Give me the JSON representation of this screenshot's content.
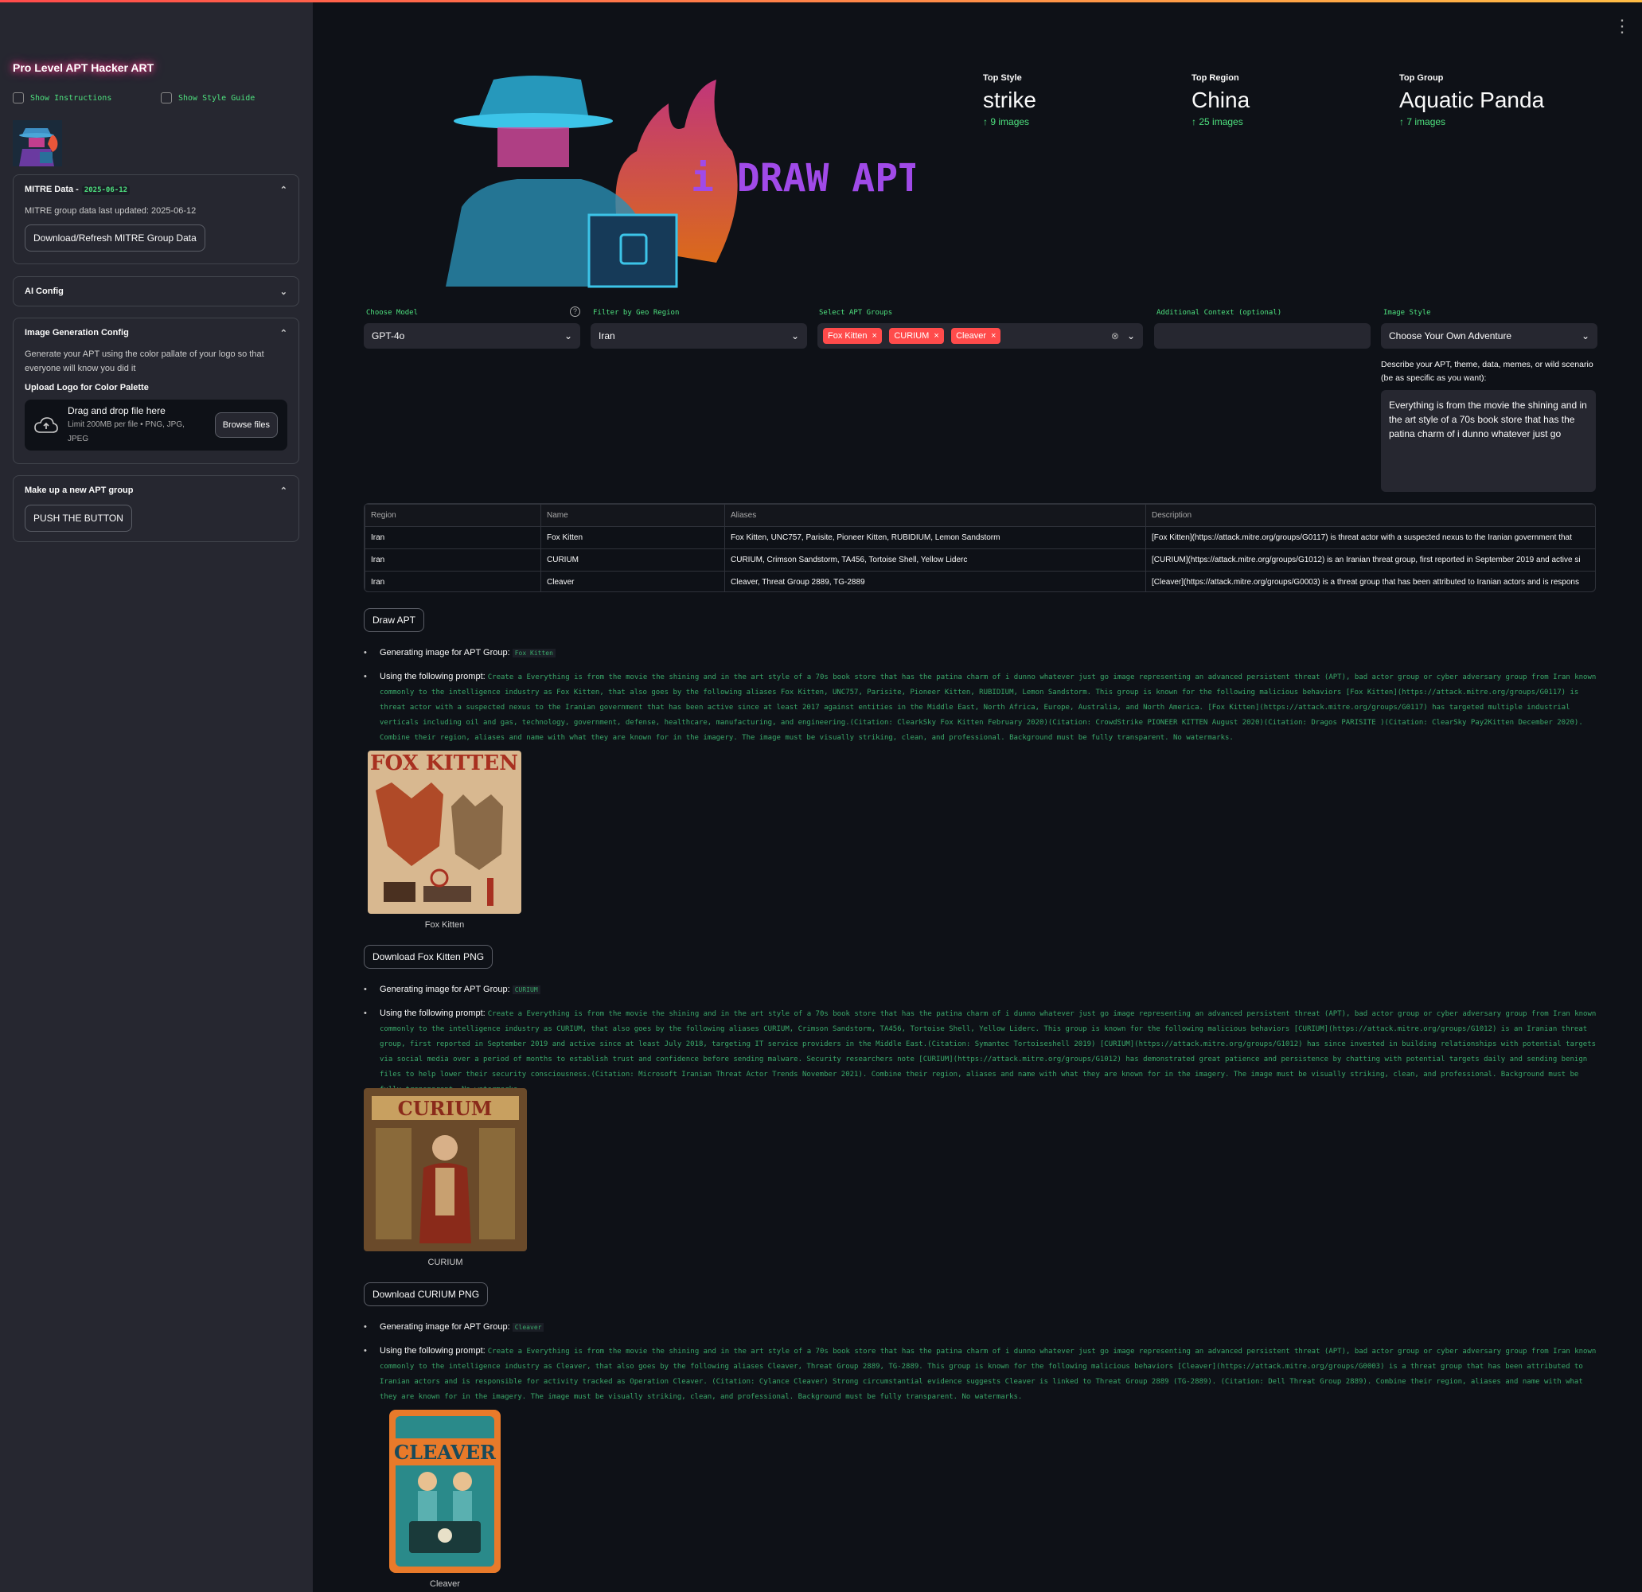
{
  "sidebar": {
    "title": "Pro Level APT Hacker ART",
    "show_instructions": "Show Instructions",
    "show_style_guide": "Show Style Guide",
    "mitre": {
      "title": "MITRE Data -",
      "date": "2025-06-12",
      "text": "MITRE group data last updated: 2025-06-12",
      "button": "Download/Refresh MITRE Group Data"
    },
    "ai_config": {
      "title": "AI Config"
    },
    "image_config": {
      "title": "Image Generation Config",
      "text": "Generate your APT using the color pallate of your logo so that everyone will know you did it",
      "upload_label": "Upload Logo for Color Palette",
      "drop_title": "Drag and drop file here",
      "drop_limit": "Limit 200MB per file • PNG, JPG, JPEG",
      "browse": "Browse files"
    },
    "new_group": {
      "title": "Make up a new APT group",
      "button": "PUSH THE BUTTON"
    }
  },
  "hero": {
    "text": "i DRAW APT"
  },
  "metrics": [
    {
      "label": "Top Style",
      "value": "strike",
      "delta": "9 images"
    },
    {
      "label": "Top Region",
      "value": "China",
      "delta": "25 images"
    },
    {
      "label": "Top Group",
      "value": "Aquatic Panda",
      "delta": "7 images"
    }
  ],
  "filters": {
    "model": {
      "label": "Choose Model",
      "value": "GPT-4o"
    },
    "region": {
      "label": "Filter by Geo Region",
      "value": "Iran"
    },
    "groups": {
      "label": "Select APT Groups",
      "tags": [
        "Fox Kitten",
        "CURIUM",
        "Cleaver"
      ]
    },
    "context": {
      "label": "Additional Context (optional)",
      "value": ""
    },
    "style": {
      "label": "Image Style",
      "value": "Choose Your Own Adventure"
    }
  },
  "describe": {
    "label": "Describe your APT, theme, data, memes, or wild scenario (be as specific as you want):",
    "value": "Everything is from the movie the shining and in the art style of a 70s book store that has the patina charm of i dunno whatever just go"
  },
  "table": {
    "headers": [
      "Region",
      "Name",
      "Aliases",
      "Description"
    ],
    "rows": [
      [
        "Iran",
        "Fox Kitten",
        "Fox Kitten, UNC757, Parisite, Pioneer Kitten, RUBIDIUM, Lemon Sandstorm",
        "[Fox Kitten](https://attack.mitre.org/groups/G0117) is threat actor with a suspected nexus to the Iranian government that"
      ],
      [
        "Iran",
        "CURIUM",
        "CURIUM, Crimson Sandstorm, TA456, Tortoise Shell, Yellow Liderc",
        "[CURIUM](https://attack.mitre.org/groups/G1012) is an Iranian threat group, first reported in September 2019 and active si"
      ],
      [
        "Iran",
        "Cleaver",
        "Cleaver, Threat Group 2889, TG-2889",
        "[Cleaver](https://attack.mitre.org/groups/G0003) is a threat group that has been attributed to Iranian actors and is respons"
      ]
    ]
  },
  "draw_button": "Draw APT",
  "generating_label": "Generating image for APT Group:",
  "prompt_label": "Using the following prompt:",
  "results": [
    {
      "group": "Fox Kitten",
      "prompt": "Create a Everything is from the movie the shining and in the art style of a 70s book store that has the patina charm of i dunno whatever just go image representing an advanced persistent threat (APT), bad actor group or cyber adversary group from Iran known commonly to the intelligence industry as Fox Kitten, that also goes by the following aliases Fox Kitten, UNC757, Parisite, Pioneer Kitten, RUBIDIUM, Lemon Sandstorm. This group is known for the following malicious behaviors [Fox Kitten](https://attack.mitre.org/groups/G0117) is threat actor with a suspected nexus to the Iranian government that has been active since at least 2017 against entities in the Middle East, North Africa, Europe, Australia, and North America. [Fox Kitten](https://attack.mitre.org/groups/G0117) has targeted multiple industrial verticals including oil and gas, technology, government, defense, healthcare, manufacturing, and engineering.(Citation: ClearkSky Fox Kitten February 2020)(Citation: CrowdStrike PIONEER KITTEN August 2020)(Citation: Dragos PARISITE )(Citation: ClearSky Pay2Kitten December 2020). Combine their region, aliases and name with what they are known for in the imagery.  The image must be visually striking, clean, and professional. Background must be fully transparent. No watermarks.",
      "image_title": "FOX KITTEN",
      "caption": "Fox Kitten",
      "download": "Download Fox Kitten PNG"
    },
    {
      "group": "CURIUM",
      "prompt": "Create a Everything is from the movie the shining and in the art style of a 70s book store that has the patina charm of i dunno whatever just go image representing an advanced persistent threat (APT), bad actor group or cyber adversary group from Iran known commonly to the intelligence industry as CURIUM, that also goes by the following aliases CURIUM, Crimson Sandstorm, TA456, Tortoise Shell, Yellow Liderc. This group is known for the following malicious behaviors [CURIUM](https://attack.mitre.org/groups/G1012) is an Iranian threat group, first reported in September 2019 and active since at least July 2018, targeting IT service providers in the Middle East.(Citation: Symantec Tortoiseshell 2019) [CURIUM](https://attack.mitre.org/groups/G1012) has since invested in building relationships with potential targets via social media over a period of months to establish trust and confidence before sending malware. Security researchers note [CURIUM](https://attack.mitre.org/groups/G1012) has demonstrated great patience and persistence by chatting with potential targets daily and sending benign files to help lower their security consciousness.(Citation: Microsoft Iranian Threat Actor Trends November 2021). Combine their region, aliases and name with what they are known for in the imagery.  The image must be visually striking, clean, and professional. Background must be fully transparent. No watermarks.",
      "image_title": "CURIUM",
      "caption": "CURIUM",
      "download": "Download CURIUM PNG"
    },
    {
      "group": "Cleaver",
      "prompt": "Create a Everything is from the movie the shining and in the art style of a 70s book store that has the patina charm of i dunno whatever just go image representing an advanced persistent threat (APT), bad actor group or cyber adversary group from Iran known commonly to the intelligence industry as Cleaver, that also goes by the following aliases Cleaver, Threat Group 2889, TG-2889. This group is known for the following malicious behaviors [Cleaver](https://attack.mitre.org/groups/G0003) is a threat group that has been attributed to Iranian actors and is responsible for activity tracked as Operation Cleaver. (Citation: Cylance Cleaver) Strong circumstantial evidence suggests Cleaver is linked to Threat Group 2889 (TG-2889). (Citation: Dell Threat Group 2889). Combine their region, aliases and name with what they are known for in the imagery.  The image must be visually striking, clean, and professional. Background must be fully transparent. No watermarks.",
      "image_title": "CLEAVER",
      "caption": "Cleaver"
    }
  ]
}
